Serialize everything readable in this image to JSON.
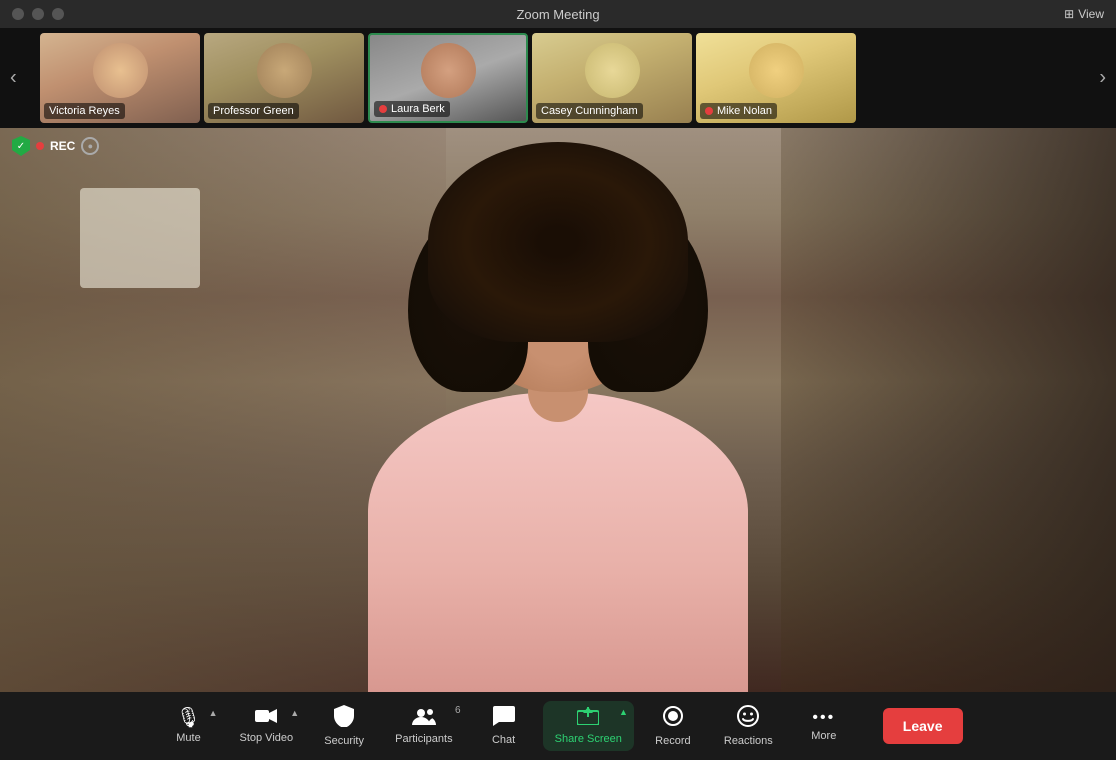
{
  "titleBar": {
    "title": "Zoom Meeting",
    "viewLabel": "View"
  },
  "participantStrip": {
    "participants": [
      {
        "name": "Victoria Reyes",
        "muted": false,
        "active": false,
        "bgClass": "tile-bg-1"
      },
      {
        "name": "Professor Green",
        "muted": false,
        "active": false,
        "bgClass": "tile-bg-2"
      },
      {
        "name": "Laura Berk",
        "muted": true,
        "active": true,
        "bgClass": "tile-bg-3"
      },
      {
        "name": "Casey Cunningham",
        "muted": false,
        "active": false,
        "bgClass": "tile-bg-4"
      },
      {
        "name": "Mike Nolan",
        "muted": true,
        "active": false,
        "bgClass": "tile-bg-5"
      }
    ]
  },
  "recIndicator": {
    "recText": "REC"
  },
  "toolbar": {
    "items": [
      {
        "id": "mute",
        "label": "Mute",
        "icon": "🎙",
        "hasCaret": true,
        "active": false
      },
      {
        "id": "stop-video",
        "label": "Stop Video",
        "icon": "📷",
        "hasCaret": true,
        "active": false
      },
      {
        "id": "security",
        "label": "Security",
        "icon": "🛡",
        "hasCaret": false,
        "active": false
      },
      {
        "id": "participants",
        "label": "Participants",
        "icon": "👥",
        "hasCaret": false,
        "active": false,
        "count": "6"
      },
      {
        "id": "chat",
        "label": "Chat",
        "icon": "💬",
        "hasCaret": false,
        "active": false
      },
      {
        "id": "share-screen",
        "label": "Share Screen",
        "icon": "⬆",
        "hasCaret": true,
        "active": true
      },
      {
        "id": "record",
        "label": "Record",
        "icon": "⏺",
        "hasCaret": false,
        "active": false
      },
      {
        "id": "reactions",
        "label": "Reactions",
        "icon": "😊",
        "hasCaret": false,
        "active": false
      },
      {
        "id": "more",
        "label": "More",
        "icon": "•••",
        "hasCaret": false,
        "active": false
      }
    ],
    "leaveLabel": "Leave"
  }
}
